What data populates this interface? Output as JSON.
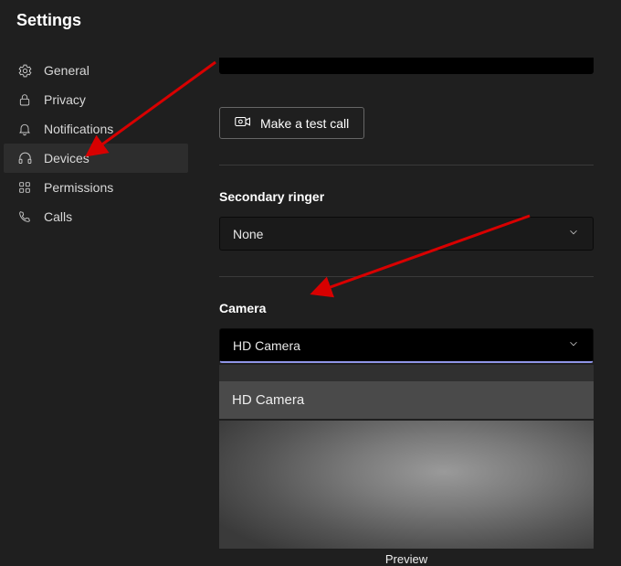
{
  "header": {
    "title": "Settings"
  },
  "sidebar": {
    "items": [
      {
        "label": "General"
      },
      {
        "label": "Privacy"
      },
      {
        "label": "Notifications"
      },
      {
        "label": "Devices"
      },
      {
        "label": "Permissions"
      },
      {
        "label": "Calls"
      }
    ]
  },
  "content": {
    "test_call_label": "Make a test call",
    "secondary_ringer": {
      "label": "Secondary ringer",
      "value": "None"
    },
    "camera": {
      "label": "Camera",
      "value": "HD Camera",
      "options": [
        "HD Camera"
      ],
      "preview_label": "Preview"
    }
  }
}
